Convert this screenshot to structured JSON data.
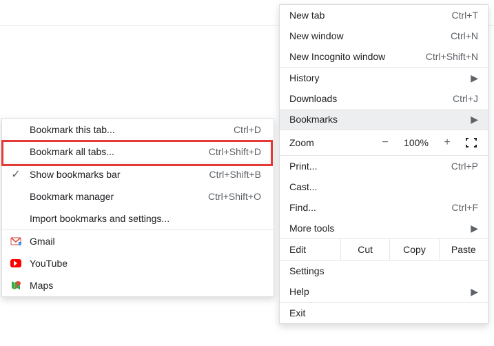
{
  "main_menu": {
    "new_tab": "New tab",
    "new_tab_sc": "Ctrl+T",
    "new_window": "New window",
    "new_window_sc": "Ctrl+N",
    "new_incognito": "New Incognito window",
    "new_incognito_sc": "Ctrl+Shift+N",
    "history": "History",
    "downloads": "Downloads",
    "downloads_sc": "Ctrl+J",
    "bookmarks": "Bookmarks",
    "zoom_label": "Zoom",
    "zoom_minus": "−",
    "zoom_pct": "100%",
    "zoom_plus": "+",
    "print": "Print...",
    "print_sc": "Ctrl+P",
    "cast": "Cast...",
    "find": "Find...",
    "find_sc": "Ctrl+F",
    "more_tools": "More tools",
    "edit": "Edit",
    "cut": "Cut",
    "copy": "Copy",
    "paste": "Paste",
    "settings": "Settings",
    "help": "Help",
    "exit": "Exit"
  },
  "bookmarks_submenu": {
    "bookmark_this_tab": "Bookmark this tab...",
    "bookmark_this_tab_sc": "Ctrl+D",
    "bookmark_all_tabs": "Bookmark all tabs...",
    "bookmark_all_tabs_sc": "Ctrl+Shift+D",
    "show_bar": "Show bookmarks bar",
    "show_bar_sc": "Ctrl+Shift+B",
    "manager": "Bookmark manager",
    "manager_sc": "Ctrl+Shift+O",
    "import": "Import bookmarks and settings...",
    "gmail": "Gmail",
    "youtube": "YouTube",
    "maps": "Maps"
  },
  "highlighted_item": "bookmark_all_tabs"
}
